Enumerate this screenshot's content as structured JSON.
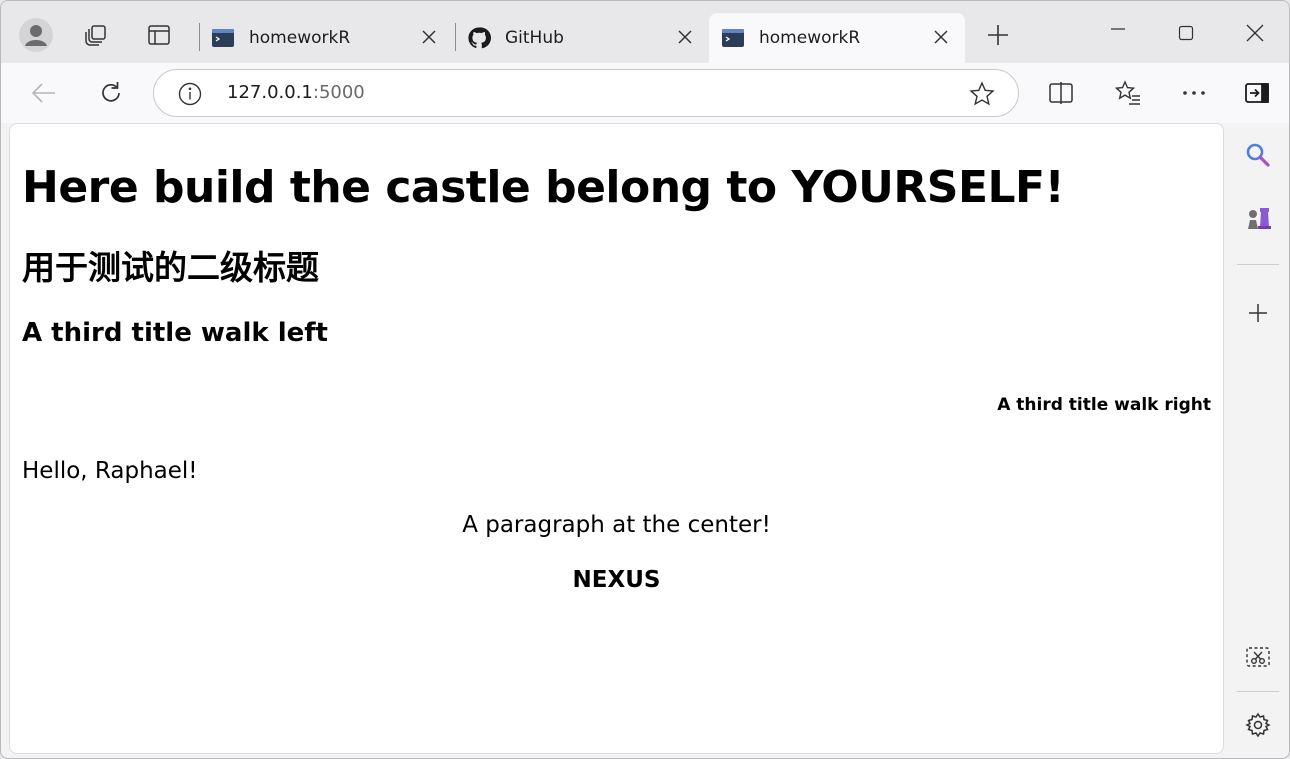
{
  "browser": {
    "tabs": [
      {
        "title": "homeworkR",
        "favicon": "terminal-icon",
        "active": false
      },
      {
        "title": "GitHub",
        "favicon": "github-icon",
        "active": false
      },
      {
        "title": "homeworkR",
        "favicon": "terminal-icon",
        "active": true
      }
    ],
    "address": {
      "host": "127.0.0.1",
      "port": ":5000"
    },
    "accent_color": "#4a6fb5"
  },
  "page": {
    "h1": "Here build the castle belong to YOURSELF!",
    "h2": "用于测试的二级标题",
    "h3": "A third title walk left",
    "h6": "A third title walk right",
    "hello": "Hello, Raphael!",
    "center": "A paragraph at the center!",
    "nexus": "NEXUS"
  }
}
